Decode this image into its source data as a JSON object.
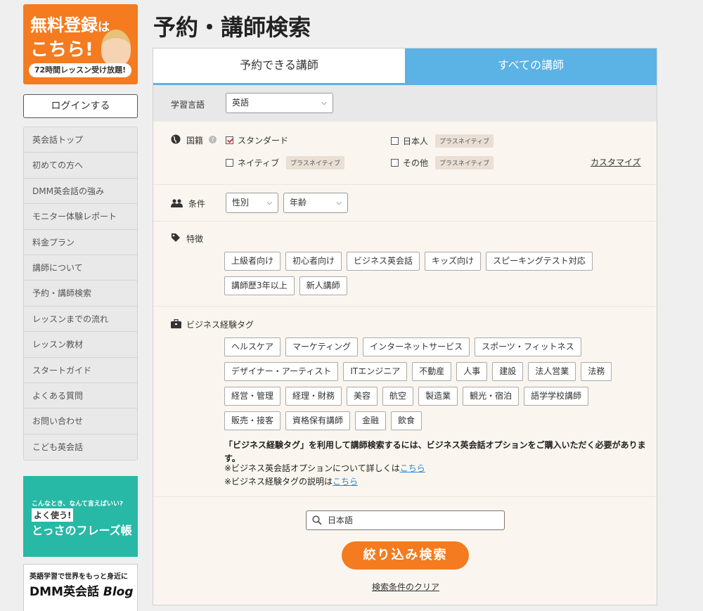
{
  "sidebar": {
    "promo": {
      "line1_main": "無料登録",
      "line1_small": "は",
      "line2": "こちら!",
      "ribbon": "72時間レッスン受け放題!"
    },
    "login": "ログインする",
    "nav": [
      "英会話トップ",
      "初めての方へ",
      "DMM英会話の強み",
      "モニター体験レポート",
      "料金プラン",
      "講師について",
      "予約・講師検索",
      "レッスンまでの流れ",
      "レッスン教材",
      "スタートガイド",
      "よくある質問",
      "お問い合わせ",
      "こども英会話"
    ],
    "banner1": {
      "small": "こんなとき、なんて言えばいい?",
      "mid": "よく使う!",
      "big": "とっさのフレーズ帳"
    },
    "banner2": {
      "top": "英語学習で世界をもっと身近に",
      "brand": "DMM英会話",
      "blog": "Blog"
    }
  },
  "title": "予約・講師検索",
  "tabs": {
    "available": "予約できる講師",
    "all": "すべての講師"
  },
  "language": {
    "label": "学習言語",
    "value": "英語"
  },
  "nationality": {
    "label": "国籍",
    "options": [
      {
        "label": "スタンダード",
        "checked": true
      },
      {
        "label": "日本人",
        "checked": false,
        "tag": "プラスネイティブ"
      },
      {
        "label": "ネイティブ",
        "checked": false,
        "tag": "プラスネイティブ"
      },
      {
        "label": "その他",
        "checked": false,
        "tag": "プラスネイティブ"
      }
    ],
    "customize": "カスタマイズ"
  },
  "conditions": {
    "label": "条件",
    "gender": "性別",
    "age": "年齢"
  },
  "features": {
    "label": "特徴",
    "tags": [
      "上級者向け",
      "初心者向け",
      "ビジネス英会話",
      "キッズ向け",
      "スピーキングテスト対応",
      "講師歴3年以上",
      "新人講師"
    ]
  },
  "business": {
    "label": "ビジネス経験タグ",
    "tags": [
      "ヘルスケア",
      "マーケティング",
      "インターネットサービス",
      "スポーツ・フィットネス",
      "デザイナー・アーティスト",
      "ITエンジニア",
      "不動産",
      "人事",
      "建設",
      "法人営業",
      "法務",
      "経営・管理",
      "経理・財務",
      "美容",
      "航空",
      "製造業",
      "観光・宿泊",
      "語学学校講師",
      "販売・接客",
      "資格保有講師",
      "金融",
      "飲食"
    ],
    "note_bold": "「ビジネス経験タグ」を利用して講師検索するには、ビジネス英会話オプションをご購入いただく必要があります。",
    "note1_prefix": "※ビジネス英会話オプションについて詳しくは",
    "note2_prefix": "※ビジネス経験タグの説明は",
    "link_text": "こちら"
  },
  "search": {
    "value": "日本語"
  },
  "submit": "絞り込み検索",
  "clear": "検索条件のクリア",
  "colors": {
    "accent_orange": "#f47b20",
    "tab_blue": "#5bb2e5"
  }
}
